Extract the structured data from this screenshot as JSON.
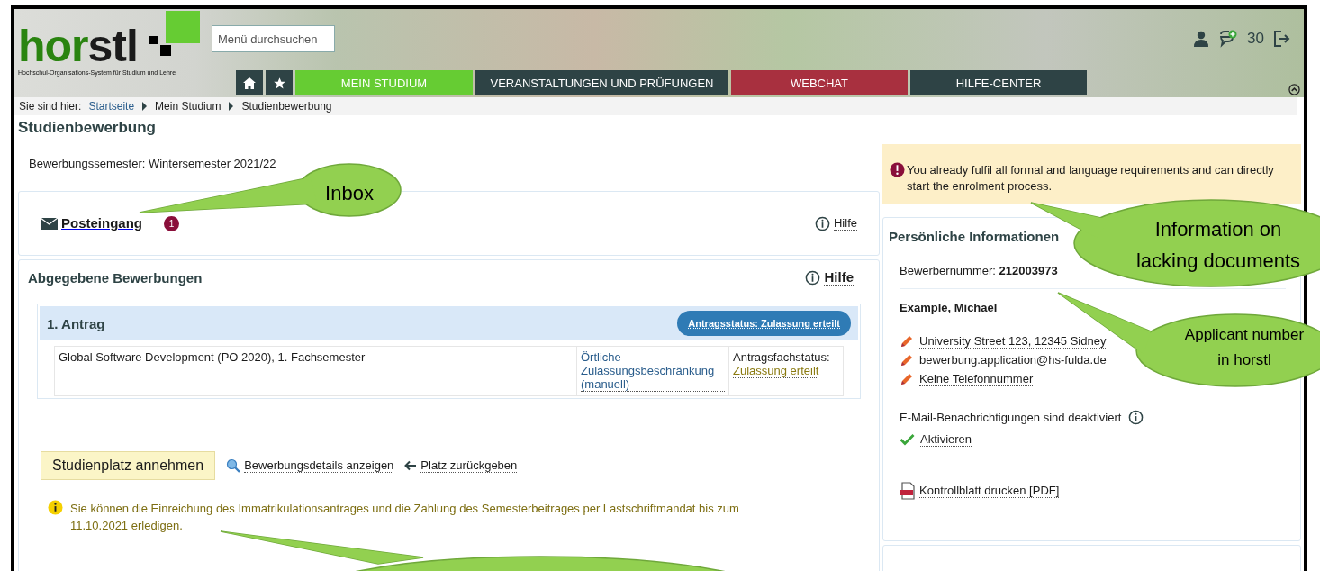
{
  "header": {
    "logo_parts": [
      "hor",
      "stl"
    ],
    "tagline": "Hochschul-Organisations-System für Studium und Lehre",
    "search": {
      "placeholder": "Menü durchsuchen"
    },
    "message_count": "30"
  },
  "nav": [
    {
      "kind": "home"
    },
    {
      "kind": "star"
    },
    {
      "kind": "tab",
      "label": "MEIN STUDIUM",
      "color": "#66cc33"
    },
    {
      "kind": "tab",
      "label": "VERANSTALTUNGEN UND PRÜFUNGEN",
      "color": "#2e4345"
    },
    {
      "kind": "tab",
      "label": "WEBCHAT",
      "color": "#a8303f"
    },
    {
      "kind": "tab",
      "label": "HILFE-CENTER",
      "color": "#2e4345"
    }
  ],
  "breadcrumb": {
    "prefix": "Sie sind hier:",
    "items": [
      "Startseite",
      "Mein Studium",
      "Studienbewerbung"
    ]
  },
  "page_title": "Studienbewerbung",
  "semester": "Bewerbungssemester: Wintersemester 2021/22",
  "inbox": {
    "label": "Posteingang",
    "count": "1",
    "help": "Hilfe"
  },
  "applications": {
    "title": "Abgegebene Bewerbungen",
    "help": "Hilfe",
    "items": [
      {
        "title": "1. Antrag",
        "status": "Antragsstatus: Zulassung erteilt",
        "program": "Global Software Development (PO 2020), 1. Fachsemester",
        "restriction": "Örtliche Zulassungsbeschränkung (manuell)",
        "subject_status_label": "Antragsfachstatus:",
        "subject_status": "Zulassung erteilt"
      }
    ]
  },
  "actions": {
    "accept": "Studienplatz annehmen",
    "details": "Bewerbungsdetails anzeigen",
    "return": "Platz zurückgeben"
  },
  "notice": "Sie können die Einreichung des Immatrikulationsantrages und die Zahlung des Semesterbeitrages per Lastschriftmandat bis zum 11.10.2021 erledigen.",
  "alert": "You already fulfil all formal and language requirements and can directly start the enrolment process.",
  "personal": {
    "title": "Persönliche Informationen",
    "applicant": "Bewerbernummer: **212003973**",
    "name": "Example, Michael",
    "contacts": [
      "University Street 123, 12345 Sidney",
      "bewerbung.application@hs-fulda.de",
      "Keine Telefonnummer"
    ],
    "notifications": "E-Mail-Benachrichtigungen sind deaktiviert",
    "activate": "Aktivieren",
    "print": "Kontrollblatt drucken [PDF]"
  },
  "callouts": [
    {
      "kind": "text",
      "lines": [
        "Inbox"
      ]
    },
    {
      "kind": "text",
      "lines": [
        "Information on",
        "lacking documents"
      ]
    },
    {
      "kind": "text",
      "lines": [
        "Applicant number",
        "in horstl"
      ]
    },
    {
      "kind": "blank"
    }
  ]
}
